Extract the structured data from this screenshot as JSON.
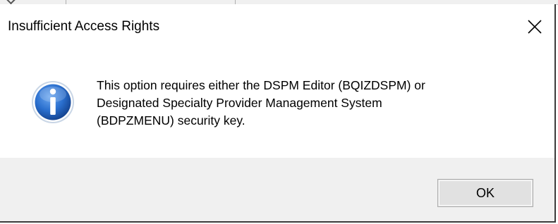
{
  "dialog": {
    "title": "Insufficient Access Rights",
    "icon": "information-icon",
    "message_lines": [
      "This option requires either the DSPM Editor (BQIZDSPM) or",
      "Designated Specialty Provider Management System",
      "(BDPZMENU) security key."
    ],
    "ok_label": "OK",
    "close_icon": "close-icon"
  },
  "colors": {
    "footer_bg": "#f0f0f0",
    "button_bg": "#e1e1e1",
    "icon_blue": "#1a5fb4"
  }
}
